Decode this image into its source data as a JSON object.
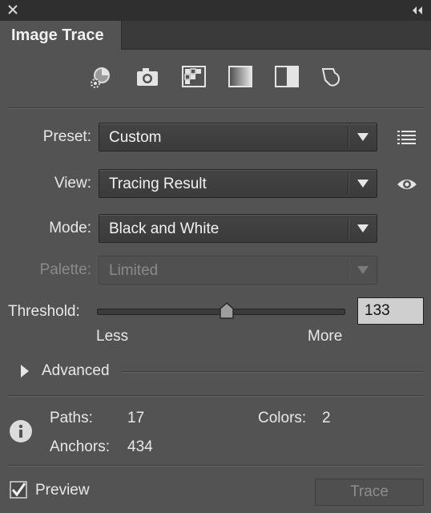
{
  "panel": {
    "title": "Image Trace"
  },
  "presets": [
    {
      "name": "auto-color-preset",
      "icon": "auto-color-gear-icon"
    },
    {
      "name": "high-color-preset",
      "icon": "camera-icon"
    },
    {
      "name": "low-color-preset",
      "icon": "grid-squares-icon"
    },
    {
      "name": "grayscale-preset",
      "icon": "grayscale-gradient-icon"
    },
    {
      "name": "black-and-white-preset",
      "icon": "half-square-icon"
    },
    {
      "name": "outline-preset",
      "icon": "outline-shape-icon"
    }
  ],
  "preset": {
    "label": "Preset:",
    "value": "Custom",
    "side_icon": "list-menu-icon"
  },
  "view": {
    "label": "View:",
    "value": "Tracing Result",
    "side_icon": "eye-icon"
  },
  "mode": {
    "label": "Mode:",
    "value": "Black and White"
  },
  "palette": {
    "label": "Palette:",
    "value": "Limited",
    "disabled": true
  },
  "threshold": {
    "label": "Threshold:",
    "value": "133",
    "min_label": "Less",
    "max_label": "More",
    "min": 0,
    "max": 255
  },
  "advanced": {
    "label": "Advanced",
    "expanded": false
  },
  "stats": {
    "paths_label": "Paths:",
    "paths_value": "17",
    "colors_label": "Colors:",
    "colors_value": "2",
    "anchors_label": "Anchors:",
    "anchors_value": "434"
  },
  "footer": {
    "preview_label": "Preview",
    "preview_checked": true,
    "trace_label": "Trace",
    "trace_disabled": true
  },
  "colors": {
    "panel_bg": "#535353",
    "titlebar_bg": "#2f2f2f",
    "text": "#e8e8e8",
    "disabled_text": "#8a8a8a"
  }
}
